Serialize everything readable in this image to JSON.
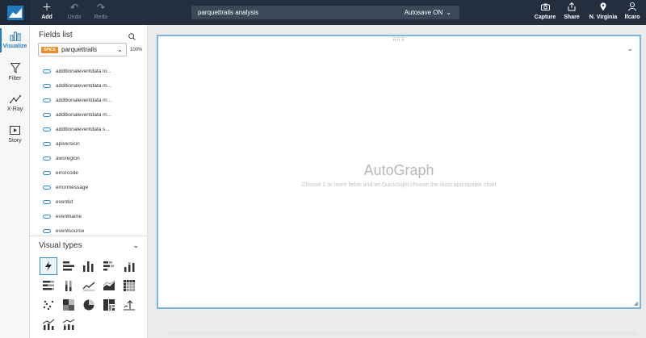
{
  "topbar": {
    "add_label": "Add",
    "undo_label": "Undo",
    "redo_label": "Redo",
    "analysis_name": "parquettrails analysis",
    "autosave_label": "Autosave ON",
    "capture_label": "Capture",
    "share_label": "Share",
    "region_label": "N. Virginia",
    "user_label": "lfcaro"
  },
  "leftnav": {
    "items": [
      {
        "label": "Visualize",
        "icon": "bar-chart-icon"
      },
      {
        "label": "Filter",
        "icon": "funnel-icon"
      },
      {
        "label": "X-Ray",
        "icon": "line-trend-icon"
      },
      {
        "label": "Story",
        "icon": "play-box-icon"
      }
    ]
  },
  "fields_panel": {
    "title": "Fields list",
    "spice_badge": "SPICE",
    "dataset": "parquettrails",
    "percent": "100%",
    "fields": [
      "additionaleventdata lo...",
      "additionaleventdata m...",
      "additionaleventdata m...",
      "additionaleventdata m...",
      "additionaleventdata s...",
      "apiversion",
      "awsregion",
      "errorcode",
      "errormessage",
      "eventid",
      "eventname",
      "eventsource"
    ]
  },
  "visual_types": {
    "title": "Visual types",
    "items": [
      "autograph-icon",
      "horizontal-bar-icon",
      "vertical-bar-icon",
      "horizontal-stacked-bar-icon",
      "vertical-stacked-bar-icon",
      "horizontal-100-bar-icon",
      "vertical-100-bar-icon",
      "line-chart-icon",
      "area-line-icon",
      "pivot-table-icon",
      "scatter-plot-icon",
      "heat-map-icon",
      "pie-chart-icon",
      "tree-map-icon",
      "kpi-icon",
      "combo-bar-line-icon",
      "combo-stacked-line-icon"
    ]
  },
  "canvas": {
    "placeholder_title": "AutoGraph",
    "placeholder_desc": "Choose 1 or more fields and let QuickSight choose the most appropriate chart"
  },
  "colors": {
    "topbar": "#232f3e",
    "accent": "#2b8ed6",
    "spice": "#f08a24"
  }
}
